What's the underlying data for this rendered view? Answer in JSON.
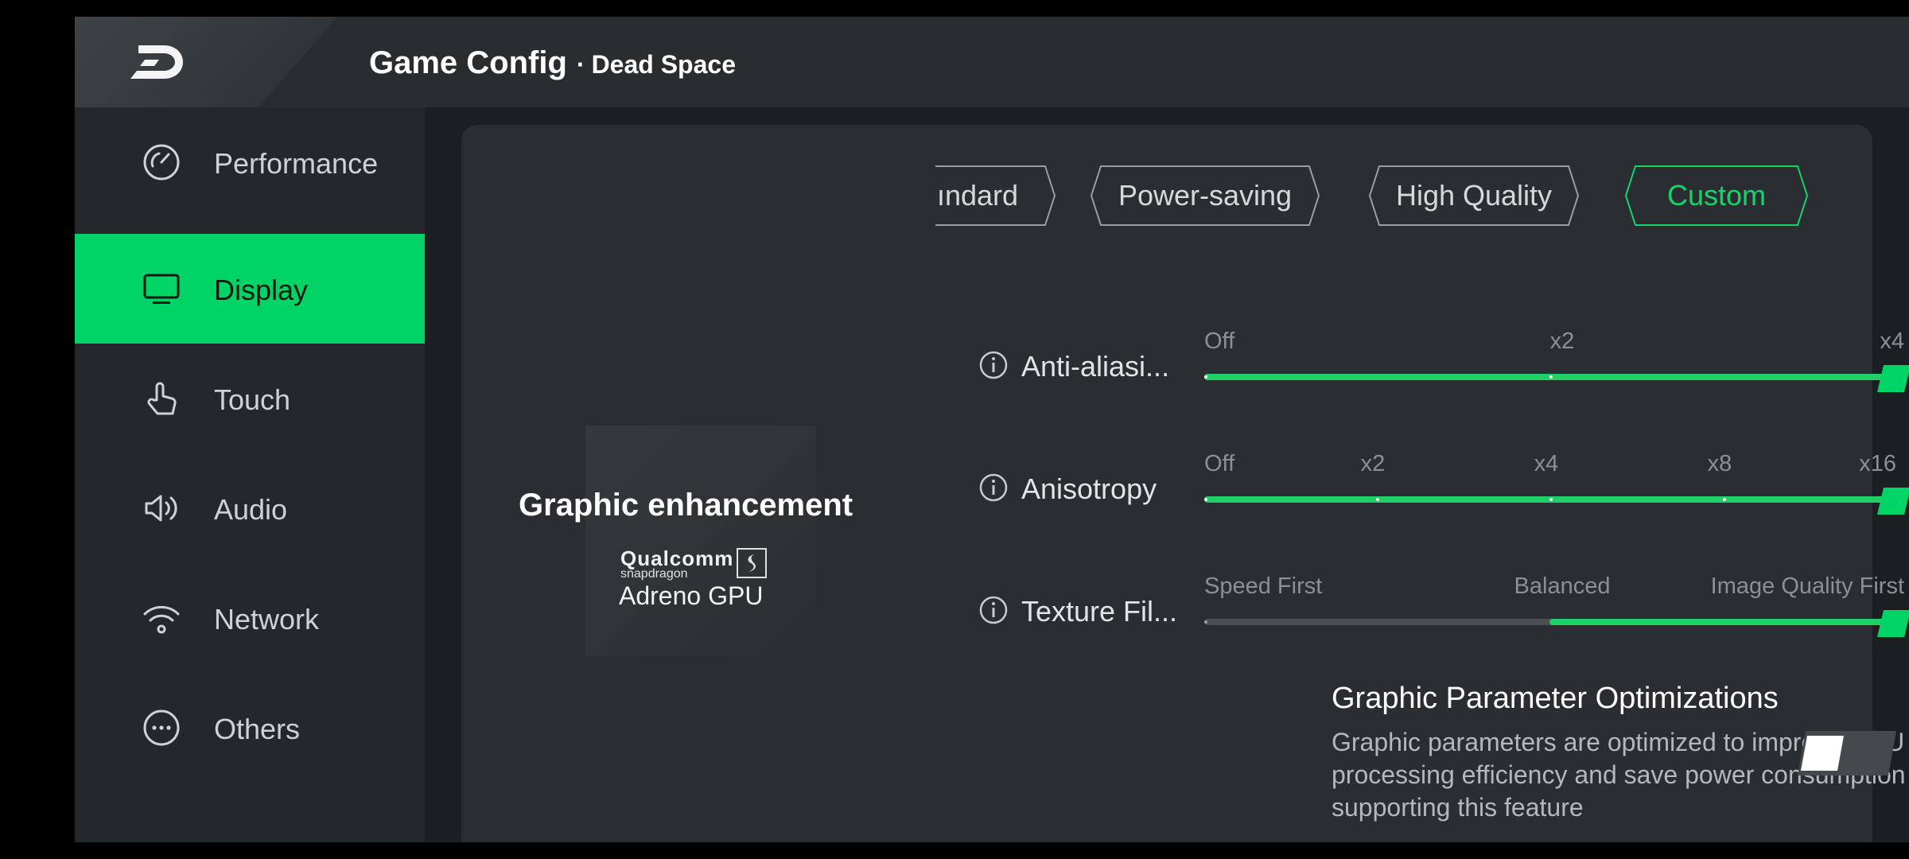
{
  "header": {
    "title": "Game Config",
    "separator": "·",
    "game": "Dead Space"
  },
  "sidebar": {
    "items": [
      {
        "label": "Performance",
        "icon": "speedometer-icon"
      },
      {
        "label": "Display",
        "icon": "monitor-icon",
        "active": true
      },
      {
        "label": "Touch",
        "icon": "touch-hand-icon"
      },
      {
        "label": "Audio",
        "icon": "speaker-icon"
      },
      {
        "label": "Network",
        "icon": "wifi-icon"
      },
      {
        "label": "Others",
        "icon": "more-dots-icon"
      }
    ]
  },
  "presets": [
    {
      "label": "ındard",
      "active": false
    },
    {
      "label": "Power-saving",
      "active": false
    },
    {
      "label": "High Quality",
      "active": false
    },
    {
      "label": "Custom",
      "active": true
    }
  ],
  "graphic": {
    "title": "Graphic enhancement",
    "brand": "Qualcomm",
    "brand_sub": "snapdragon",
    "gpu": "Adreno GPU"
  },
  "settings": [
    {
      "label": "Anti-aliasi...",
      "ticks": [
        "Off",
        "x2",
        "x4"
      ],
      "value_index": 2
    },
    {
      "label": "Anisotropy",
      "ticks": [
        "Off",
        "x2",
        "x4",
        "x8",
        "x16"
      ],
      "value_index": 4
    },
    {
      "label": "Texture Fil...",
      "ticks": [
        "Speed First",
        "Balanced",
        "Image Quality First"
      ],
      "value_index": 2
    }
  ],
  "optimization": {
    "title": "Graphic Parameter Optimizations",
    "description": "Graphic parameters are optimized to improve GPU processing efficiency and save power consumption for games supporting this feature",
    "enabled": false
  },
  "colors": {
    "accent": "#00d466",
    "background": "#1c1f22",
    "card": "#2a2d31"
  }
}
